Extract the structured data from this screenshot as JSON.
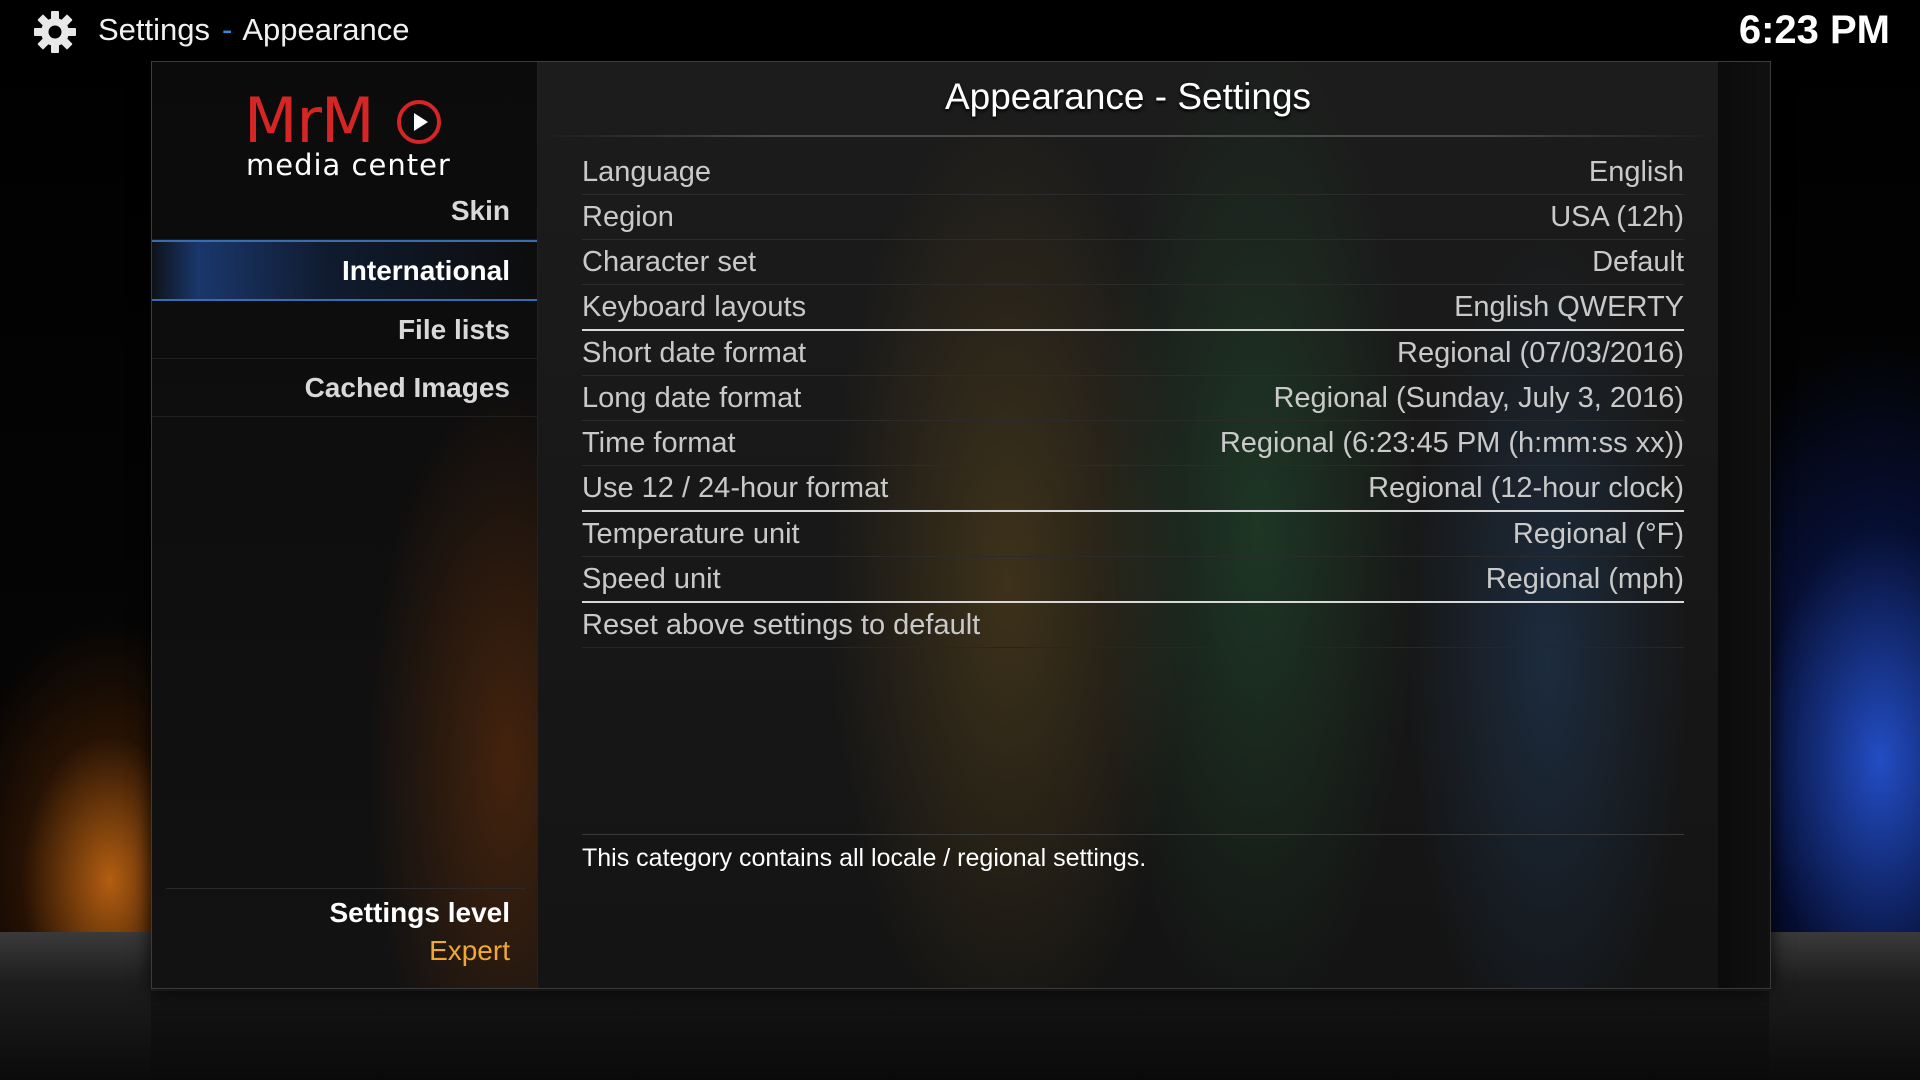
{
  "header": {
    "breadcrumb_root": "Settings",
    "breadcrumb_sep": "-",
    "breadcrumb_page": "Appearance",
    "clock": "6:23 PM",
    "icon": "gear-icon"
  },
  "logo": {
    "brand": "MrM",
    "subtitle": "media center"
  },
  "sidebar": {
    "items": [
      {
        "label": "Skin",
        "active": false
      },
      {
        "label": "International",
        "active": true
      },
      {
        "label": "File lists",
        "active": false
      },
      {
        "label": "Cached Images",
        "active": false
      }
    ],
    "settings_level_label": "Settings level",
    "settings_level_value": "Expert"
  },
  "content": {
    "title": "Appearance - Settings",
    "rows": [
      {
        "label": "Language",
        "value": "English"
      },
      {
        "label": "Region",
        "value": "USA (12h)"
      },
      {
        "label": "Character set",
        "value": "Default"
      },
      {
        "label": "Keyboard layouts",
        "value": "English QWERTY"
      },
      {
        "label": "Short date format",
        "value": "Regional (07/03/2016)"
      },
      {
        "label": "Long date format",
        "value": "Regional (Sunday, July 3, 2016)"
      },
      {
        "label": "Time format",
        "value": "Regional (6:23:45 PM (h:mm:ss xx))"
      },
      {
        "label": "Use 12 / 24-hour format",
        "value": "Regional (12-hour clock)"
      },
      {
        "label": "Temperature unit",
        "value": "Regional (°F)"
      },
      {
        "label": "Speed unit",
        "value": "Regional (mph)"
      },
      {
        "label": "Reset above settings to default",
        "value": ""
      }
    ],
    "description": "This category contains all locale / regional settings."
  },
  "colors": {
    "accent_blue": "#2f8de4",
    "brand_red": "#d62525",
    "level_orange": "#f0a830"
  }
}
